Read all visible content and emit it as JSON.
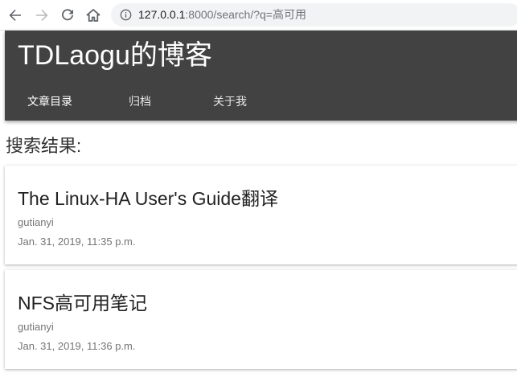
{
  "browser": {
    "url_host": "127.0.0.1",
    "url_rest": ":8000/search/?q=高可用",
    "icons": [
      "back-arrow-icon",
      "forward-arrow-icon",
      "reload-icon",
      "home-icon",
      "info-icon"
    ]
  },
  "header": {
    "site_title": "TDLaogu的博客",
    "background_color": "#424242",
    "nav": {
      "toc": "文章目录",
      "archive": "归档",
      "about": "关于我"
    }
  },
  "main": {
    "heading": "搜索结果:",
    "results": [
      {
        "title": "The Linux-HA User's Guide翻译",
        "author": "gutianyi",
        "date": "Jan. 31, 2019, 11:35 p.m."
      },
      {
        "title": "NFS高可用笔记",
        "author": "gutianyi",
        "date": "Jan. 31, 2019, 11:36 p.m."
      }
    ]
  }
}
